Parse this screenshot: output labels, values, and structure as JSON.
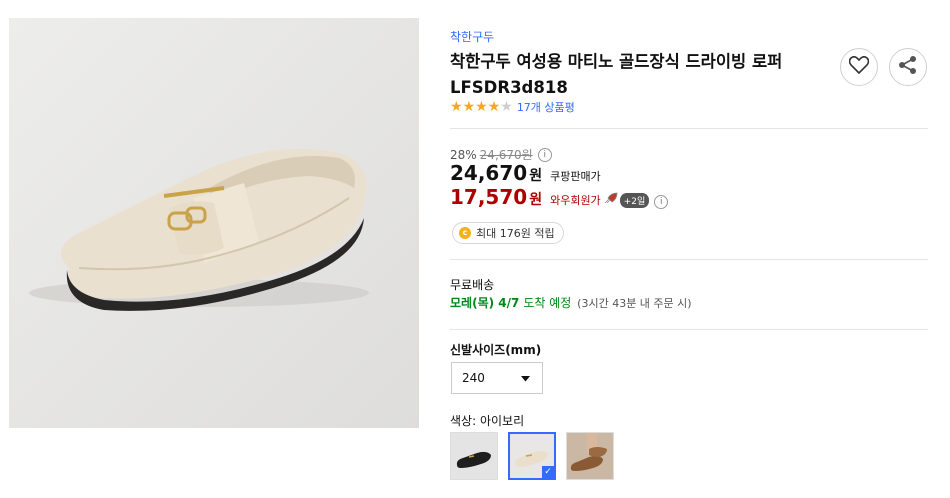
{
  "product": {
    "brand": "착한구두",
    "title": "착한구두 여성용 마티노 골드장식 드라이빙 로퍼 LFSDR3d818",
    "rating_stars": 4,
    "review_text": "17개 상품평"
  },
  "actions": {
    "wishlist_icon": "heart-icon",
    "share_icon": "share-icon"
  },
  "pricing": {
    "discount_rate": "28%",
    "original_price": "24,670원",
    "sale_price": "24,670",
    "sale_unit": "원",
    "sale_label": "쿠팡판매가",
    "wow_price": "17,570",
    "wow_unit": "원",
    "wow_label": "와우회원가",
    "wow_badge": "+2일",
    "info_icon": "i"
  },
  "reward": {
    "text": "최대 176원 적립",
    "coin_symbol": "c"
  },
  "shipping": {
    "title": "무료배송",
    "date": "모레(목) 4/7",
    "arrive": "도착 예정",
    "note": "(3시간 43분 내 주문 시)"
  },
  "options": {
    "size_title": "신발사이즈(mm)",
    "size_value": "240",
    "color_label": "색상:",
    "color_value": "아이보리",
    "selected_color_index": 1
  },
  "colors": {
    "accent": "#346aff",
    "wow": "#ae0000",
    "shipping": "#00891a",
    "star": "#f5a623"
  }
}
